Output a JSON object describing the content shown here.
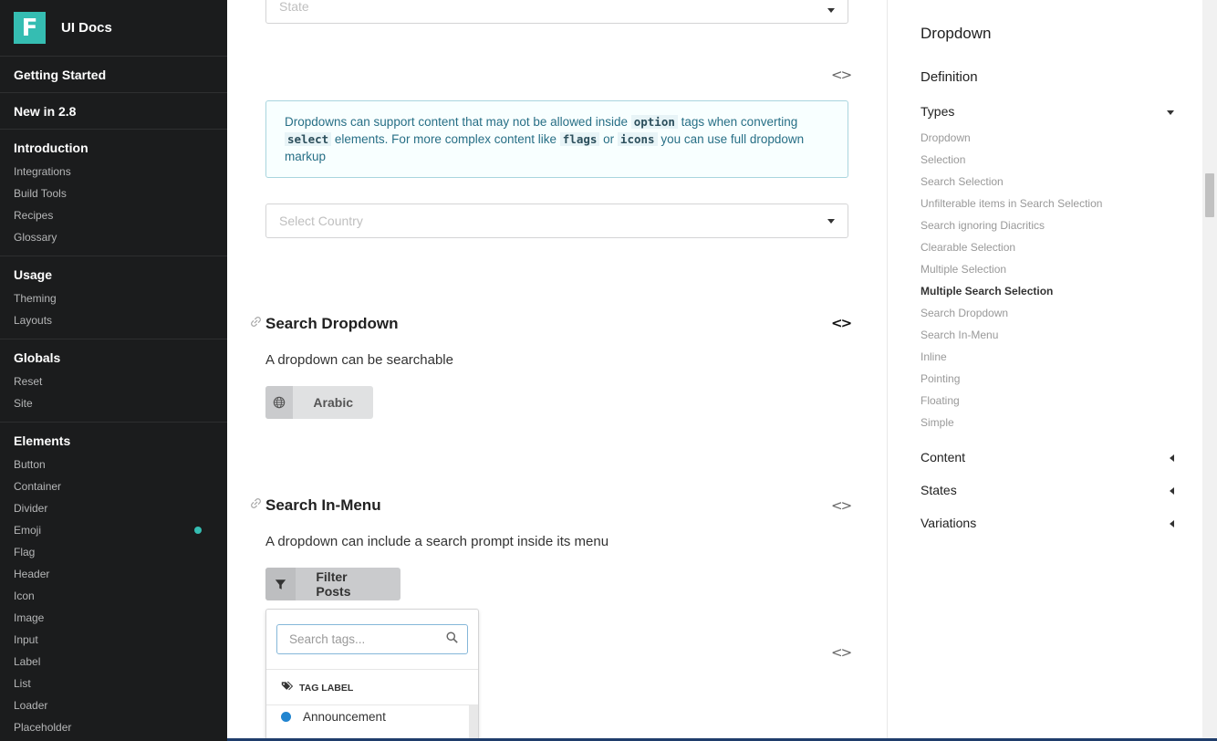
{
  "brand": {
    "logo_letter": "F",
    "title": "UI Docs"
  },
  "sidebar": {
    "top_links": [
      "Getting Started",
      "New in 2.8"
    ],
    "sections": [
      {
        "title": "Introduction",
        "items": [
          "Integrations",
          "Build Tools",
          "Recipes",
          "Glossary"
        ]
      },
      {
        "title": "Usage",
        "items": [
          "Theming",
          "Layouts"
        ]
      },
      {
        "title": "Globals",
        "items": [
          "Reset",
          "Site"
        ]
      },
      {
        "title": "Elements",
        "items": [
          "Button",
          "Container",
          "Divider",
          "Emoji",
          "Flag",
          "Header",
          "Icon",
          "Image",
          "Input",
          "Label",
          "List",
          "Loader",
          "Placeholder"
        ]
      }
    ],
    "new_badge_item": "Emoji",
    "accent_color": "#35bdb2"
  },
  "main": {
    "state_dropdown": {
      "placeholder": "State"
    },
    "info": {
      "t1": "Dropdowns can support content that may not be allowed inside ",
      "c1": "option",
      "t2": " tags when converting ",
      "c2": "select",
      "t3": " elements. For more complex content like ",
      "c3": "flags",
      "t4": " or ",
      "c4": "icons",
      "t5": " you can use full dropdown markup"
    },
    "country_dropdown": {
      "placeholder": "Select Country"
    },
    "search_dropdown": {
      "title": "Search Dropdown",
      "description": "A dropdown can be searchable",
      "button_label": "Arabic",
      "button_icon": "globe-icon"
    },
    "search_in_menu": {
      "title": "Search In-Menu",
      "description": "A dropdown can include a search prompt inside its menu",
      "button_label": "Filter Posts",
      "button_icon": "filter-icon",
      "menu": {
        "search_placeholder": "Search tags...",
        "header": "TAG LABEL",
        "items": [
          {
            "label": "Announcement",
            "color": "#2185d0"
          }
        ]
      }
    },
    "code_toggle_symbol": "<>"
  },
  "toc": {
    "title": "Dropdown",
    "definition": "Definition",
    "types": {
      "label": "Types",
      "items": [
        "Dropdown",
        "Selection",
        "Search Selection",
        "Unfilterable items in Search Selection",
        "Search ignoring Diacritics",
        "Clearable Selection",
        "Multiple Selection",
        "Multiple Search Selection",
        "Search Dropdown",
        "Search In-Menu",
        "Inline",
        "Pointing",
        "Floating",
        "Simple"
      ],
      "active": "Multiple Search Selection"
    },
    "collapsed": [
      "Content",
      "States",
      "Variations"
    ]
  }
}
